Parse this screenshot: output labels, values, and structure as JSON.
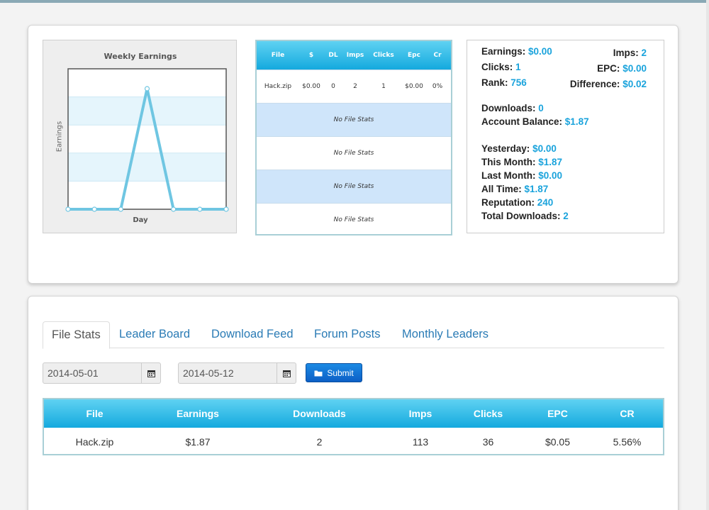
{
  "chart_data": {
    "type": "line",
    "title": "Weekly Earnings",
    "xlabel": "Day",
    "ylabel": "Earnings",
    "x": [
      1,
      2,
      3,
      4,
      5,
      6,
      7
    ],
    "series": [
      {
        "values": [
          0,
          0,
          0,
          1.0,
          0,
          0,
          0
        ]
      }
    ],
    "ylim": [
      0,
      1.0
    ],
    "grid": true,
    "colors": {
      "line": "#6fc6e2",
      "band": "#e5f5fc"
    }
  },
  "mini_table": {
    "headers": [
      "File",
      "$",
      "DL",
      "Imps",
      "Clicks",
      "Epc",
      "Cr"
    ],
    "row": [
      "Hack.zip",
      "$0.00",
      "0",
      "2",
      "1",
      "$0.00",
      "0%"
    ],
    "empty_rows": [
      "No File Stats",
      "No File Stats",
      "No File Stats",
      "No File Stats"
    ]
  },
  "stats": {
    "earnings_label": "Earnings:",
    "earnings_value": "$0.00",
    "imps_label": "Imps:",
    "imps_value": "2",
    "clicks_label": "Clicks:",
    "clicks_value": "1",
    "epc_label": "EPC:",
    "epc_value": "$0.00",
    "rank_label": "Rank:",
    "rank_value": "756",
    "difference_label": "Difference:",
    "difference_value": "$0.02",
    "downloads_label": "Downloads:",
    "downloads_value": "0",
    "balance_label": "Account Balance:",
    "balance_value": "$1.87",
    "yesterday_label": "Yesterday:",
    "yesterday_value": "$0.00",
    "this_month_label": "This Month:",
    "this_month_value": "$1.87",
    "last_month_label": "Last Month:",
    "last_month_value": "$0.00",
    "all_time_label": "All Time:",
    "all_time_value": "$1.87",
    "reputation_label": "Reputation:",
    "reputation_value": "240",
    "total_downloads_label": "Total Downloads:",
    "total_downloads_value": "2"
  },
  "tabs": [
    "File Stats",
    "Leader Board",
    "Download Feed",
    "Forum Posts",
    "Monthly Leaders"
  ],
  "filters": {
    "start_date": "2014-05-01",
    "end_date": "2014-05-12",
    "submit_label": "Submit",
    "calendar_icon": "calendar-icon",
    "submit_icon": "folder-icon"
  },
  "file_table": {
    "headers": [
      "File",
      "Earnings",
      "Downloads",
      "Imps",
      "Clicks",
      "EPC",
      "CR"
    ],
    "rows": [
      [
        "Hack.zip",
        "$1.87",
        "2",
        "113",
        "36",
        "$0.05",
        "5.56%"
      ]
    ]
  },
  "colors": {
    "accent": "#1aa3dc",
    "link": "#2a7bb5",
    "header_gradient_top": "#5fd2f2",
    "header_gradient_bottom": "#14a9de",
    "submit_blue": "#0c5fc6"
  }
}
